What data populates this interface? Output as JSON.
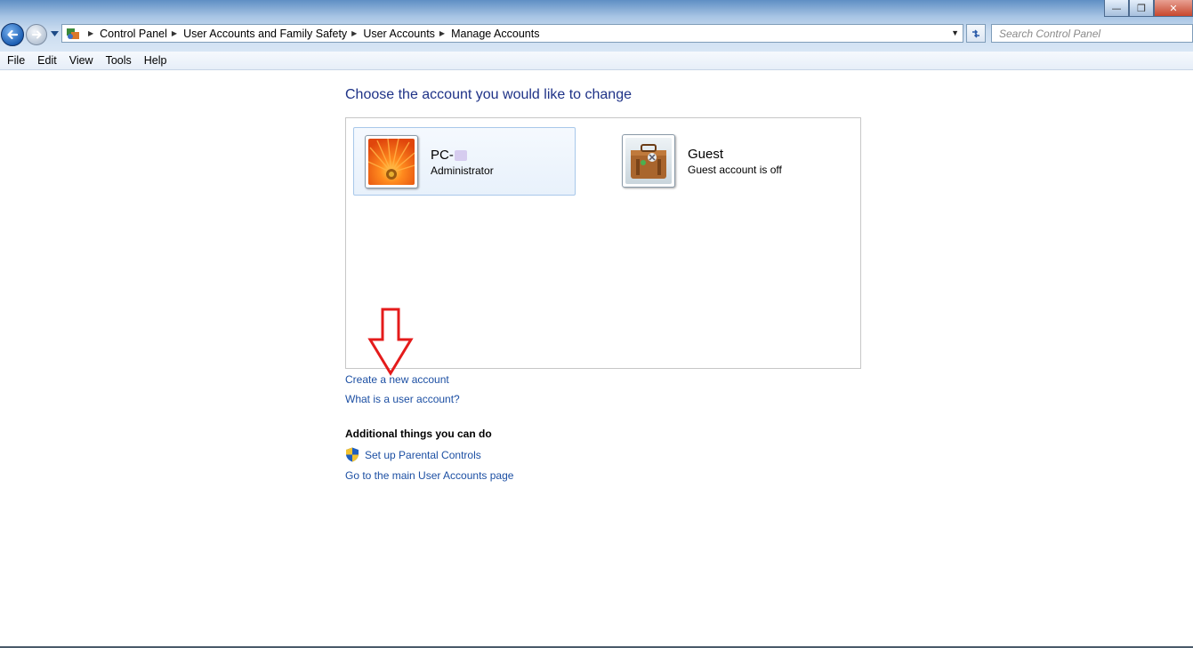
{
  "window": {
    "minimize_glyph": "—",
    "maximize_glyph": "❒",
    "close_glyph": "✕"
  },
  "address_bar": {
    "icon": "control-panel-icon",
    "breadcrumbs": [
      "Control Panel",
      "User Accounts and Family Safety",
      "User Accounts",
      "Manage Accounts"
    ]
  },
  "search": {
    "placeholder": "Search Control Panel"
  },
  "menu": {
    "items": [
      "File",
      "Edit",
      "View",
      "Tools",
      "Help"
    ]
  },
  "content": {
    "heading": "Choose the account you would like to change",
    "accounts": [
      {
        "name": "PC-",
        "role": "Administrator",
        "picture": "orange-flower-picture",
        "selected": true
      },
      {
        "name": "Guest",
        "role": "Guest account is off",
        "picture": "suitcase-picture",
        "selected": false
      }
    ],
    "links": {
      "create_account": "Create a new account",
      "what_is_account": "What is a user account?"
    },
    "additional": {
      "title": "Additional things you can do",
      "parental_controls": "Set up Parental Controls",
      "main_page": "Go to the main User Accounts page"
    }
  },
  "colors": {
    "heading": "#1e3287",
    "link": "#1c4fa3",
    "annotation_arrow": "#e41b1b",
    "selected_bg": "#e8f1fb"
  }
}
